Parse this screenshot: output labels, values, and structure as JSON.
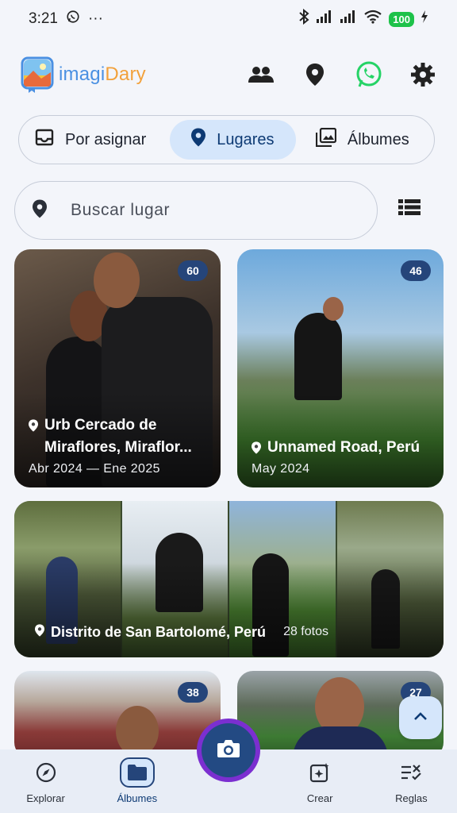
{
  "status": {
    "time": "3:21",
    "more": "···",
    "battery": "100"
  },
  "app": {
    "name_a": "imagi",
    "name_b": "Dary"
  },
  "tabs": [
    {
      "label": "Por asignar",
      "icon": "inbox-icon"
    },
    {
      "label": "Lugares",
      "icon": "location-pin-icon",
      "active": true
    },
    {
      "label": "Álbumes",
      "icon": "photo-library-icon"
    }
  ],
  "search": {
    "placeholder": "Buscar lugar"
  },
  "places": [
    {
      "title": "Urb Cercado de Miraflores, Miraflor...",
      "subtitle": "Abr 2024 — Ene 2025",
      "count": "60"
    },
    {
      "title": "Unnamed Road, Perú",
      "subtitle": "May 2024",
      "count": "46"
    },
    {
      "title": "Distrito de San Bartolomé, Perú",
      "subtitle": "28 fotos"
    },
    {
      "count": "38"
    },
    {
      "count": "27"
    }
  ],
  "nav": [
    {
      "label": "Explorar",
      "icon": "compass-icon"
    },
    {
      "label": "Álbumes",
      "icon": "folder-icon",
      "active": true
    },
    {
      "label": "",
      "icon": "camera-icon"
    },
    {
      "label": "Crear",
      "icon": "magic-create-icon"
    },
    {
      "label": "Reglas",
      "icon": "rules-icon"
    }
  ],
  "colors": {
    "accent": "#25457a",
    "active_bg": "#d5e6fb",
    "camera_ring": "#7b2fd0",
    "whatsapp": "#25d366"
  }
}
